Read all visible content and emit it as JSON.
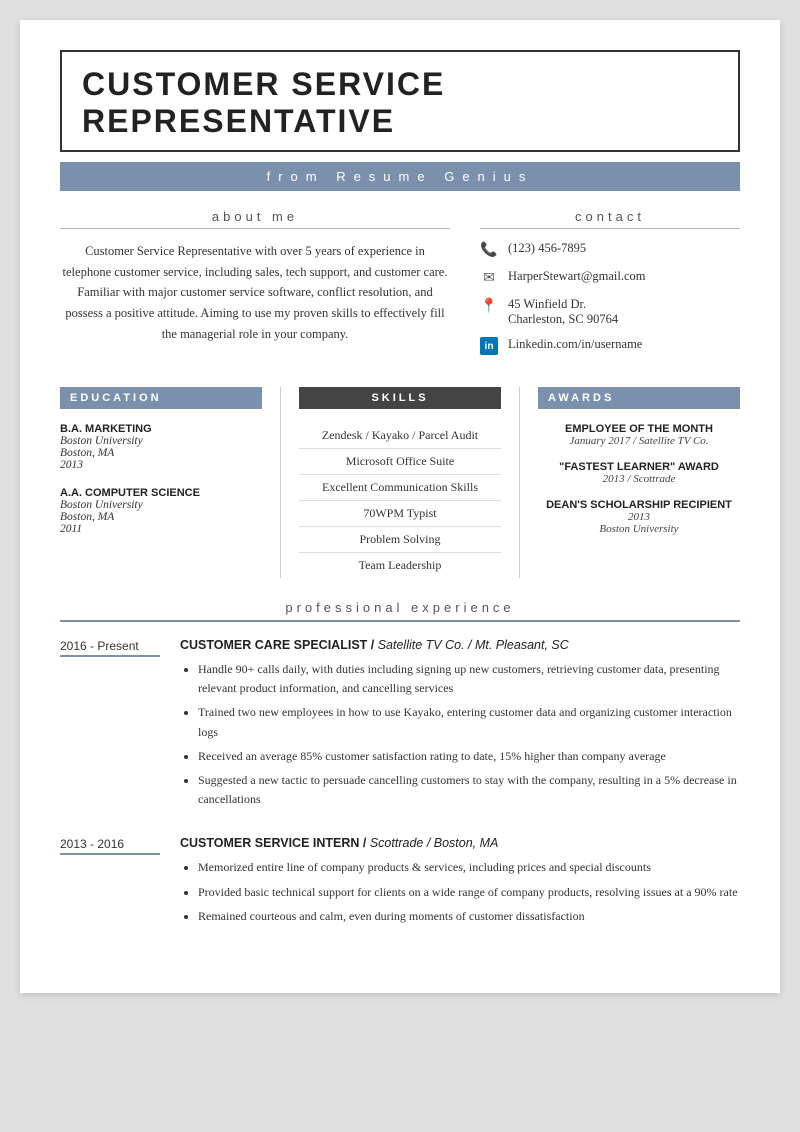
{
  "resume": {
    "title": "CUSTOMER SERVICE REPRESENTATIVE",
    "source": "from Resume Genius",
    "about_heading": "about me",
    "about_text": "Customer Service Representative with over 5 years of experience in telephone customer service, including sales, tech support, and customer care. Familiar with major customer service software, conflict resolution, and possess a positive attitude. Aiming to use my proven skills to effectively fill the managerial role in your company.",
    "contact": {
      "heading": "contact",
      "phone": "(123) 456-7895",
      "email": "HarperStewart@gmail.com",
      "address_line1": "45 Winfield Dr.",
      "address_line2": "Charleston, SC 90764",
      "linkedin": "Linkedin.com/in/username"
    },
    "education": {
      "heading": "EDUCATION",
      "entries": [
        {
          "degree": "B.A. MARKETING",
          "school": "Boston University",
          "city": "Boston, MA",
          "year": "2013"
        },
        {
          "degree": "A.A. COMPUTER SCIENCE",
          "school": "Boston University",
          "city": "Boston, MA",
          "year": "2011"
        }
      ]
    },
    "skills": {
      "heading": "SKILLS",
      "items": [
        "Zendesk / Kayako / Parcel Audit",
        "Microsoft Office Suite",
        "Excellent Communication Skills",
        "70WPM Typist",
        "Problem Solving",
        "Team Leadership"
      ]
    },
    "awards": {
      "heading": "AWARDS",
      "entries": [
        {
          "title": "EMPLOYEE OF THE MONTH",
          "detail": "January 2017 / Satellite TV Co."
        },
        {
          "title": "\"FASTEST LEARNER\" AWARD",
          "detail": "2013 / Scottrade"
        },
        {
          "title": "DEAN'S SCHOLARSHIP RECIPIENT",
          "detail_line1": "2013",
          "detail_line2": "Boston University"
        }
      ]
    },
    "experience": {
      "heading": "professional experience",
      "jobs": [
        {
          "dates": "2016 - Present",
          "title": "CUSTOMER CARE SPECIALIST /",
          "title_italic": " Satellite TV Co. /  Mt. Pleasant, SC",
          "bullets": [
            "Handle 90+ calls daily, with duties including signing up new customers, retrieving customer data, presenting relevant product information, and cancelling services",
            "Trained two new employees in how to use Kayako, entering customer data and organizing customer interaction logs",
            "Received an average 85% customer satisfaction rating to date, 15% higher than company average",
            "Suggested a new tactic to persuade cancelling customers to stay with the company, resulting in a 5% decrease in cancellations"
          ]
        },
        {
          "dates": "2013 - 2016",
          "title": "CUSTOMER SERVICE INTERN /",
          "title_italic": " Scottrade / Boston, MA",
          "bullets": [
            "Memorized entire line of company products & services, including prices and special discounts",
            "Provided basic technical support for clients on a wide range of company products, resolving issues at a 90% rate",
            "Remained courteous and calm, even during moments of customer dissatisfaction"
          ]
        }
      ]
    }
  }
}
